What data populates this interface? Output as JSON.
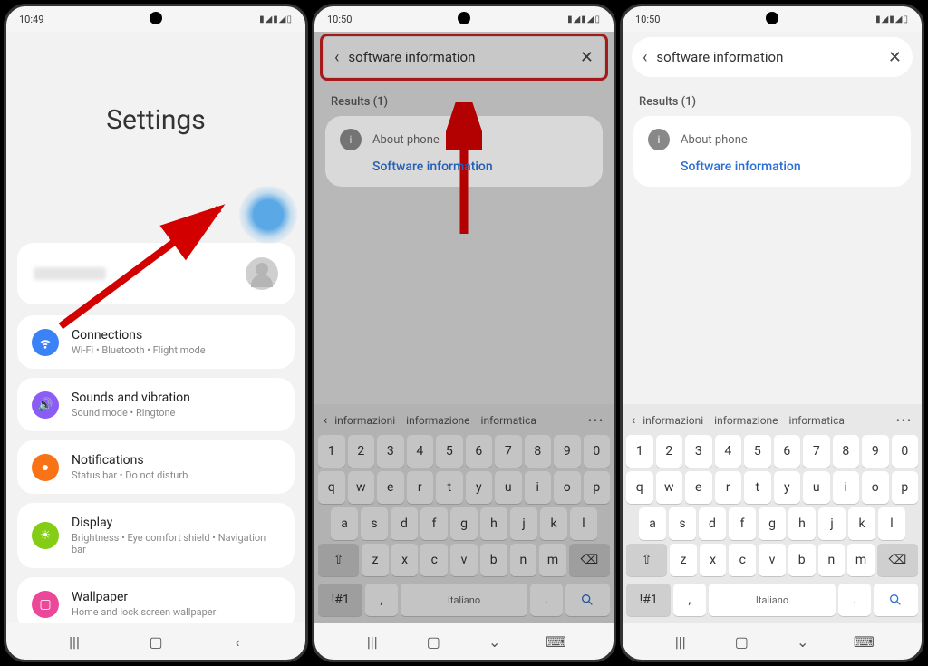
{
  "screen1": {
    "time": "10:49",
    "status_l": "◎ ✕ ○",
    "status_r": "▮◢▮◢▯",
    "title": "Settings",
    "items": [
      {
        "title": "Connections",
        "subtitle": "Wi-Fi  •  Bluetooth  •  Flight mode"
      },
      {
        "title": "Sounds and vibration",
        "subtitle": "Sound mode  •  Ringtone"
      },
      {
        "title": "Notifications",
        "subtitle": "Status bar  •  Do not disturb"
      },
      {
        "title": "Display",
        "subtitle": "Brightness  •  Eye comfort shield  •  Navigation bar"
      },
      {
        "title": "Wallpaper",
        "subtitle": "Home and lock screen wallpaper"
      }
    ]
  },
  "screen2": {
    "time": "10:50",
    "status_l": "◎ ✕ ○",
    "status_r": "▮◢▮◢▯",
    "search_value": "software information",
    "results_label": "Results (1)",
    "result_parent": "About phone",
    "result_link": "Software information",
    "suggestions": [
      "informazioni",
      "informazione",
      "informatica"
    ],
    "space_label": "Italiano",
    "sym_label": "!#1"
  },
  "screen3": {
    "time": "10:50",
    "status_l": "◎ ✕ ○",
    "status_r": "▮◢▮◢▯",
    "search_value": "software information",
    "results_label": "Results (1)",
    "result_parent": "About phone",
    "result_link": "Software information",
    "suggestions": [
      "informazioni",
      "informazione",
      "informatica"
    ],
    "space_label": "Italiano",
    "sym_label": "!#1"
  },
  "kb": {
    "row1": [
      "1",
      "2",
      "3",
      "4",
      "5",
      "6",
      "7",
      "8",
      "9",
      "0"
    ],
    "row2": [
      "q",
      "w",
      "e",
      "r",
      "t",
      "y",
      "u",
      "i",
      "o",
      "p"
    ],
    "row3": [
      "a",
      "s",
      "d",
      "f",
      "g",
      "h",
      "j",
      "k",
      "l"
    ],
    "row4": [
      "z",
      "x",
      "c",
      "v",
      "b",
      "n",
      "m"
    ]
  }
}
